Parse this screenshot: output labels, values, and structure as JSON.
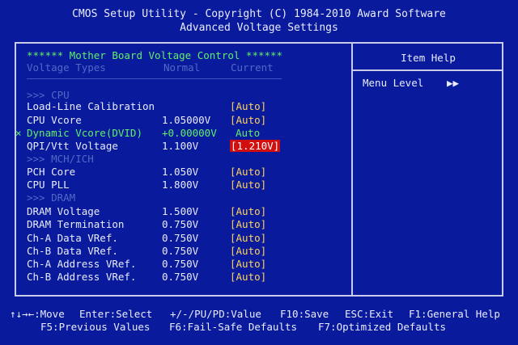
{
  "header": {
    "title": "CMOS Setup Utility - Copyright (C) 1984-2010 Award Software",
    "subtitle": "Advanced Voltage Settings"
  },
  "panel": {
    "title": "****** Mother Board Voltage Control ******",
    "columns": {
      "type": "Voltage Types",
      "normal": "Normal",
      "current": "Current"
    },
    "sections": {
      "cpu": ">>> CPU",
      "mch": ">>> MCH/ICH",
      "dram": ">>> DRAM"
    },
    "disabled_marker": "×",
    "rows": [
      {
        "label": "Load-Line Calibration",
        "normal": "",
        "current": "[Auto]"
      },
      {
        "label": "CPU Vcore",
        "normal": "1.05000V",
        "current": "[Auto]"
      },
      {
        "label": "Dynamic Vcore(DVID)",
        "normal": "+0.00000V",
        "current": "Auto"
      },
      {
        "label": "QPI/Vtt Voltage",
        "normal": "1.100V",
        "current": "[1.210V]"
      },
      {
        "label": "PCH Core",
        "normal": "1.050V",
        "current": "[Auto]"
      },
      {
        "label": "CPU PLL",
        "normal": "1.800V",
        "current": "[Auto]"
      },
      {
        "label": "DRAM Voltage",
        "normal": "1.500V",
        "current": "[Auto]"
      },
      {
        "label": "DRAM Termination",
        "normal": "0.750V",
        "current": "[Auto]"
      },
      {
        "label": "Ch-A Data VRef.",
        "normal": "0.750V",
        "current": "[Auto]"
      },
      {
        "label": "Ch-B Data VRef.",
        "normal": "0.750V",
        "current": "[Auto]"
      },
      {
        "label": "Ch-A Address VRef.",
        "normal": "0.750V",
        "current": "[Auto]"
      },
      {
        "label": "Ch-B Address VRef.",
        "normal": "0.750V",
        "current": "[Auto]"
      }
    ]
  },
  "help": {
    "title": "Item Help",
    "menu_level": "Menu Level",
    "menu_arrow": "▶▶"
  },
  "footer": {
    "line1": [
      "↑↓→←:Move",
      "Enter:Select",
      "+/-/PU/PD:Value",
      "F10:Save",
      "ESC:Exit",
      "F1:General Help"
    ],
    "line2": [
      "F5:Previous Values",
      "F6:Fail-Safe Defaults",
      "F7:Optimized Defaults"
    ]
  },
  "colors": {
    "background": "#0a1a9c",
    "text": "#e8ecff",
    "value": "#ffd35a",
    "title_green": "#5ff06a",
    "dim": "#5468c6",
    "highlight": "#d20f0f"
  }
}
